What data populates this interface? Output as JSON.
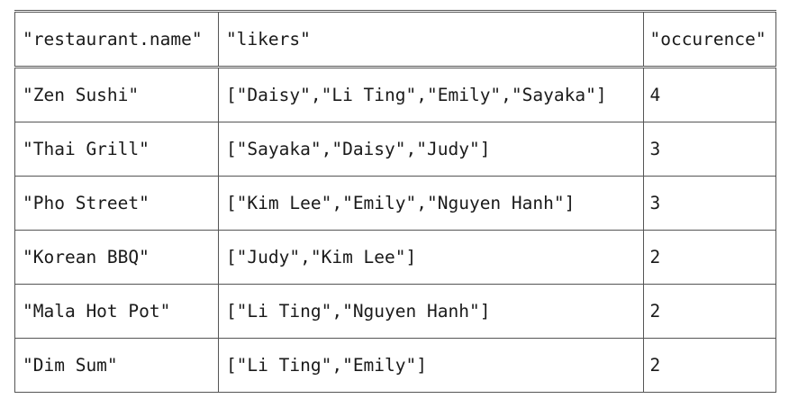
{
  "table": {
    "headers": [
      "\"restaurant.name\"",
      "\"likers\"",
      "\"occurence\""
    ],
    "rows": [
      {
        "name": "\"Zen Sushi\"",
        "likers": "[\"Daisy\",\"Li Ting\",\"Emily\",\"Sayaka\"]",
        "occurence": "4"
      },
      {
        "name": "\"Thai Grill\"",
        "likers": "[\"Sayaka\",\"Daisy\",\"Judy\"]",
        "occurence": "3"
      },
      {
        "name": "\"Pho Street\"",
        "likers": "[\"Kim Lee\",\"Emily\",\"Nguyen Hanh\"]",
        "occurence": "3"
      },
      {
        "name": "\"Korean BBQ\"",
        "likers": "[\"Judy\",\"Kim Lee\"]",
        "occurence": "2"
      },
      {
        "name": "\"Mala Hot Pot\"",
        "likers": "[\"Li Ting\",\"Nguyen Hanh\"]",
        "occurence": "2"
      },
      {
        "name": "\"Dim Sum\"",
        "likers": "[\"Li Ting\",\"Emily\"]",
        "occurence": "2"
      }
    ]
  }
}
